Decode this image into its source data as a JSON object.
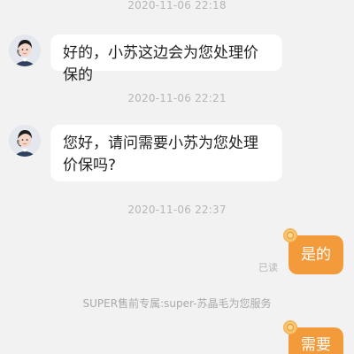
{
  "timestamps": {
    "t1": "2020-11-06 22:18",
    "t2": "2020-11-06 22:21",
    "t3": "2020-11-06 22:37"
  },
  "messages": {
    "agent_1": "好的，小苏这边会为您处理价保的",
    "agent_2": "您好，请问需要小苏为您处理价保吗?",
    "user_1": "是的",
    "user_2": "需要"
  },
  "status": {
    "read": "已读"
  },
  "system": {
    "notice": "SUPER售前专属:super-苏晶毛为您服务"
  },
  "icons": {
    "agent_avatar": "customer-service-avatar",
    "user_badge": "coin-badge-icon"
  },
  "colors": {
    "background": "#f2f2f2",
    "agent_bubble": "#ffffff",
    "user_bubble": "#f39b3b",
    "timestamp": "#b6b6b6"
  }
}
